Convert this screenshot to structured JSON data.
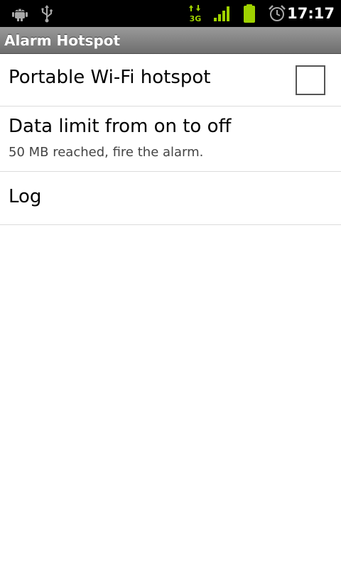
{
  "status_bar": {
    "time": "17:17",
    "icons": [
      "android-debug-icon",
      "usb-icon",
      "3g-data-icon",
      "signal-icon",
      "battery-icon",
      "alarm-clock-icon"
    ],
    "accent_color": "#9fd200"
  },
  "title_bar": {
    "title": "Alarm Hotspot"
  },
  "preferences": [
    {
      "title": "Portable Wi-Fi hotspot",
      "checked": false
    },
    {
      "title": "Data limit from on to off",
      "summary": "50 MB reached, fire the alarm."
    },
    {
      "title": "Log"
    }
  ]
}
